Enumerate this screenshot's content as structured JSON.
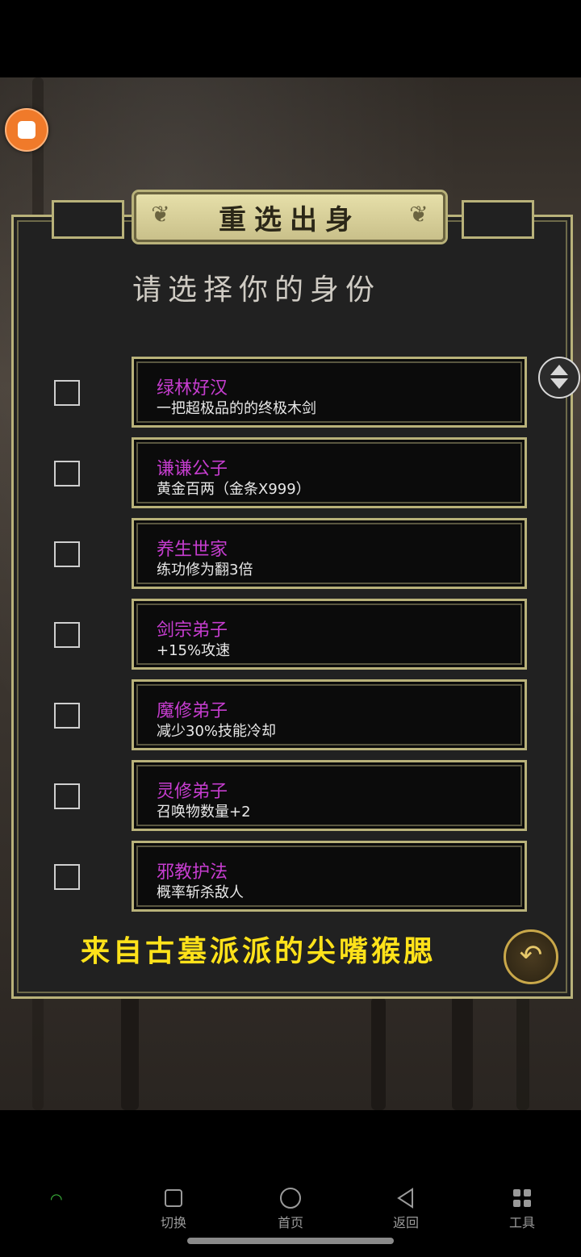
{
  "title": "重选出身",
  "subtitle": "请选择你的身份",
  "options": [
    {
      "name": "绿林好汉",
      "desc": "一把超极品的的终极木剑",
      "checked": false
    },
    {
      "name": "谦谦公子",
      "desc": "黄金百两（金条X999）",
      "checked": false
    },
    {
      "name": "养生世家",
      "desc": "练功修为翻3倍",
      "checked": false
    },
    {
      "name": "剑宗弟子",
      "desc": "+15%攻速",
      "checked": false
    },
    {
      "name": "魔修弟子",
      "desc": "减少30%技能冷却",
      "checked": false
    },
    {
      "name": "灵修弟子",
      "desc": "召唤物数量+2",
      "checked": false
    },
    {
      "name": "邪教护法",
      "desc": "概率斩杀敌人",
      "checked": false
    }
  ],
  "footer": "来自古墓派派的尖嘴猴腮",
  "nav": {
    "switch": "切换",
    "home": "首页",
    "back": "返回",
    "tools": "工具"
  },
  "colors": {
    "option_name": "#c63dcf",
    "footer_text": "#ffe21a",
    "frame": "#b9b27a"
  }
}
